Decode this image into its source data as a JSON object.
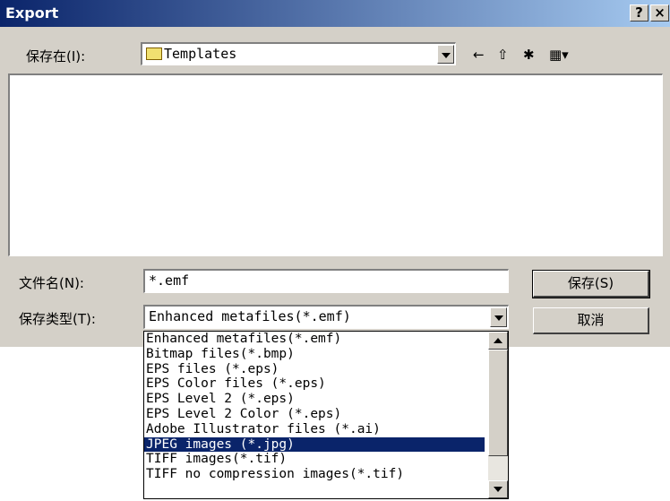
{
  "window": {
    "title": "Export",
    "help": "?",
    "close": "×"
  },
  "savein": {
    "label": "保存在(I):",
    "value": "Templates",
    "icons": {
      "back": "←",
      "up": "⇧",
      "newfolder": "✱",
      "view": "▦▾"
    }
  },
  "filename": {
    "label": "文件名(N):",
    "value": "*.emf"
  },
  "filetype": {
    "label": "保存类型(T):",
    "value": "Enhanced metafiles(*.emf)",
    "options": [
      "Enhanced metafiles(*.emf)",
      "Bitmap files(*.bmp)",
      "EPS files (*.eps)",
      "EPS Color files (*.eps)",
      "EPS Level 2 (*.eps)",
      "EPS Level 2 Color (*.eps)",
      "Adobe Illustrator files (*.ai)",
      "JPEG images (*.jpg)",
      "TIFF images(*.tif)",
      "TIFF no compression images(*.tif)"
    ],
    "selected_index": 7
  },
  "buttons": {
    "save": "保存(S)",
    "cancel": "取消"
  },
  "colors": {
    "title_start": "#0a246a",
    "title_end": "#a6caf0",
    "selection": "#0a246a",
    "face": "#d4d0c8"
  }
}
